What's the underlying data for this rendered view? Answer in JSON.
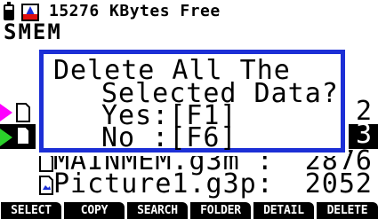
{
  "status": {
    "memory_text": "15276 KBytes Free"
  },
  "title": "SMEM",
  "files": [
    {
      "name": "",
      "size": "",
      "marker": "none",
      "selected": false
    },
    {
      "name": "",
      "size": "",
      "marker": "none",
      "selected": false
    },
    {
      "name": "",
      "size": "2",
      "marker": "magenta",
      "selected": false
    },
    {
      "name": "",
      "size": "3",
      "marker": "green",
      "selected": true
    },
    {
      "name": "MAINMEM.g3m :",
      "size": "2876",
      "marker": "none",
      "selected": false
    },
    {
      "name": "Picture1.g3p:",
      "size": "2052",
      "marker": "none",
      "selected": false
    }
  ],
  "dialog": {
    "line1": "Delete All The",
    "line2": "Selected Data?",
    "yes": "Yes:[F1]",
    "no": "No :[F6]"
  },
  "function_keys": [
    "SELECT",
    "COPY",
    "SEARCH",
    "FOLDER",
    "DETAIL",
    "DELETE"
  ],
  "colors": {
    "dialog_border": "#1c2fd6",
    "pointer_magenta": "#ff00ff",
    "pointer_green": "#2bd12b"
  }
}
